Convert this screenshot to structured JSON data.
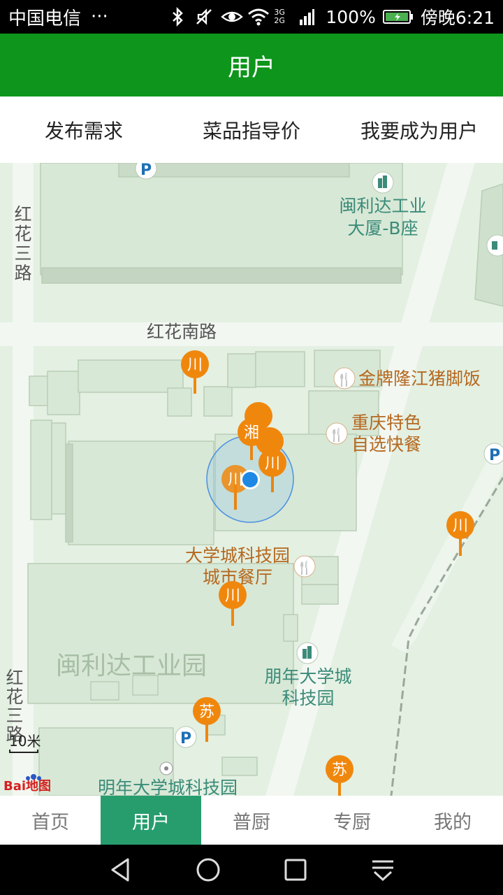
{
  "status_bar": {
    "carrier": "中国电信",
    "more": "···",
    "network": "3G 2G",
    "battery": "100%",
    "time": "傍晚6:21"
  },
  "header": {
    "title": "用户"
  },
  "top_tabs": [
    {
      "label": "发布需求"
    },
    {
      "label": "菜品指导价"
    },
    {
      "label": "我要成为用户"
    }
  ],
  "map": {
    "roads": [
      "红花三路",
      "红花南路",
      "红花三路"
    ],
    "pois": [
      {
        "name": "闽利达工业大厦-B座",
        "lines": [
          "闽利达工业",
          "大厦-B座"
        ]
      },
      {
        "name": "金牌隆江猪脚饭"
      },
      {
        "name": "重庆特色自选快餐",
        "lines": [
          "重庆特色",
          "自选快餐"
        ]
      },
      {
        "name": "大学城科技园城市餐厅",
        "lines": [
          "大学城科技园",
          "城市餐厅"
        ]
      },
      {
        "name": "闽利达工业园"
      },
      {
        "name": "朋年大学城科技园",
        "lines": [
          "朋年大学城",
          "科技园"
        ]
      },
      {
        "name": "明年大学城科技园"
      }
    ],
    "markers": [
      "川",
      "湘",
      "川",
      "川",
      "川",
      "川",
      "苏",
      "苏"
    ],
    "parking": "P",
    "scale": "10米",
    "logo": "Bai地图",
    "colors": {
      "marker": "#f0870d",
      "location": "#1e88e5",
      "poi_green": "#3b8b79",
      "poi_orange": "#b5681f"
    }
  },
  "bottom_nav": [
    {
      "label": "首页",
      "active": false
    },
    {
      "label": "用户",
      "active": true
    },
    {
      "label": "普厨",
      "active": false
    },
    {
      "label": "专厨",
      "active": false
    },
    {
      "label": "我的",
      "active": false
    }
  ],
  "system_nav": [
    "back-icon",
    "home-icon",
    "recents-icon",
    "notification-pull-icon"
  ]
}
